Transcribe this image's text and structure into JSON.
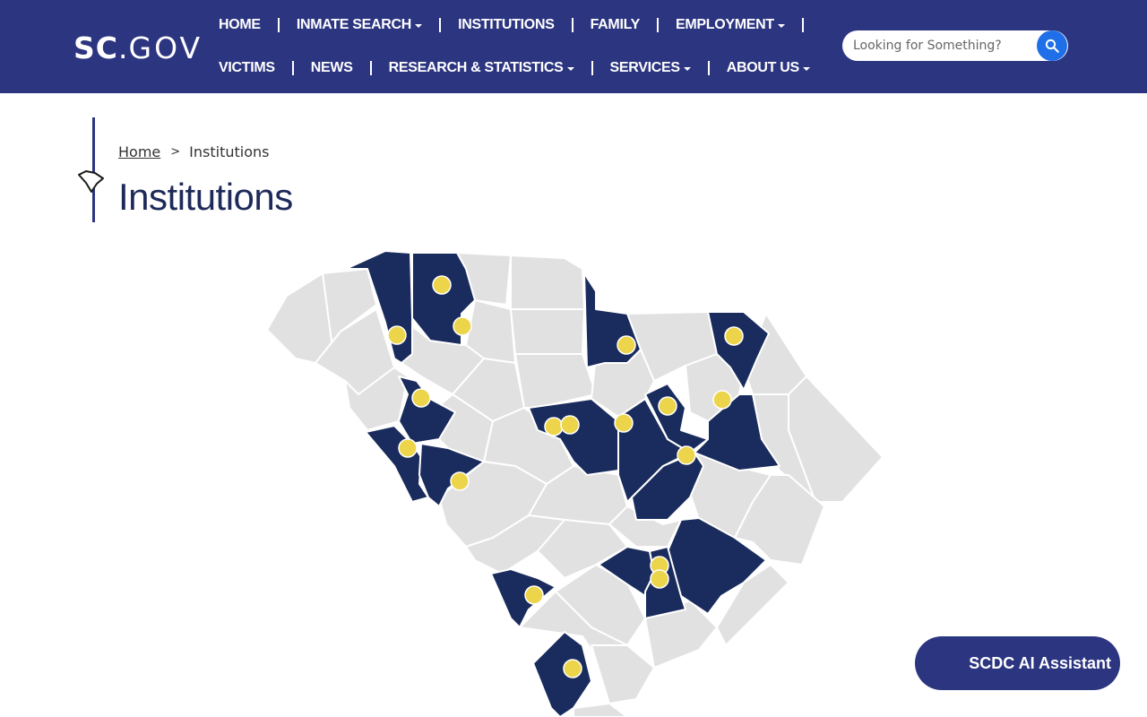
{
  "header": {
    "logo_sc": "SC",
    "logo_dot": ".",
    "logo_gov": "GOV",
    "nav_row1": [
      {
        "label": "HOME",
        "dropdown": false
      },
      {
        "label": "INMATE SEARCH",
        "dropdown": true
      },
      {
        "label": "INSTITUTIONS",
        "dropdown": false
      },
      {
        "label": "FAMILY",
        "dropdown": false
      },
      {
        "label": "EMPLOYMENT",
        "dropdown": true
      }
    ],
    "nav_row2": [
      {
        "label": "VICTIMS",
        "dropdown": false
      },
      {
        "label": "NEWS",
        "dropdown": false
      },
      {
        "label": "RESEARCH & STATISTICS",
        "dropdown": true
      },
      {
        "label": "SERVICES",
        "dropdown": true
      },
      {
        "label": "ABOUT US",
        "dropdown": true
      }
    ],
    "search": {
      "placeholder": "Looking for Something?",
      "value": "",
      "icon": "search-icon"
    }
  },
  "breadcrumb": {
    "home": "Home",
    "separator": ">",
    "current": "Institutions"
  },
  "page_title": "Institutions",
  "map": {
    "icon": "south-carolina-state-icon",
    "highlight_color": "#1a2c5d",
    "base_color": "#e1e1e1",
    "marker_color": "#ecd54a"
  },
  "ai_assistant": {
    "label": "SCDC AI Assistant"
  },
  "colors": {
    "header_bg": "#2c3580",
    "search_button": "#1e6fe8",
    "title_text": "#1e2a5a"
  }
}
